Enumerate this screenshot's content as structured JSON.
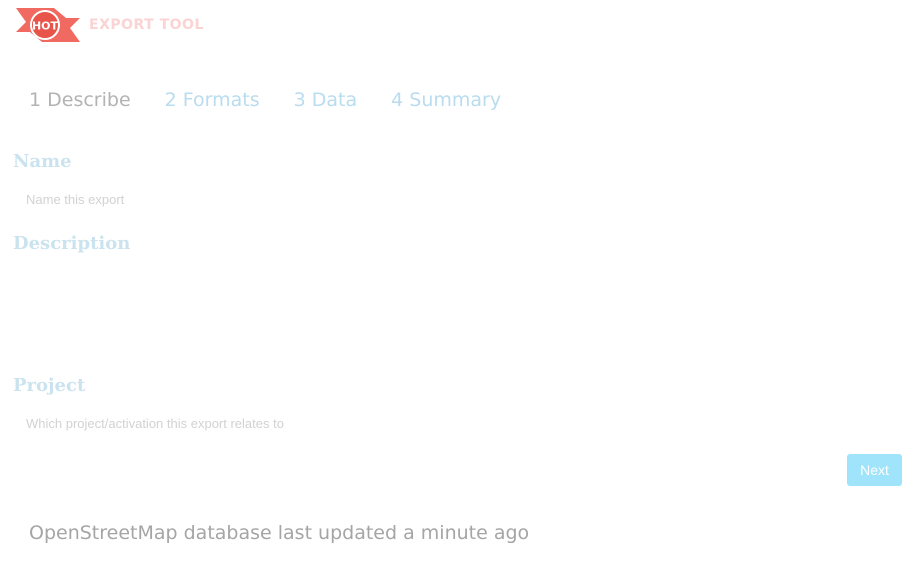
{
  "header": {
    "logo_text": "HOT",
    "brand_title": "EXPORT TOOL",
    "logo_icon": "hot-logo-icon",
    "brand_color": "#e8534a"
  },
  "steps": [
    {
      "label": "1 Describe",
      "active": true
    },
    {
      "label": "2 Formats",
      "active": false
    },
    {
      "label": "3 Data",
      "active": false
    },
    {
      "label": "4 Summary",
      "active": false
    }
  ],
  "form": {
    "name": {
      "label": "Name",
      "placeholder": "Name this export",
      "value": ""
    },
    "description": {
      "label": "Description",
      "value": ""
    },
    "project": {
      "label": "Project",
      "placeholder": "Which project/activation this export relates to",
      "value": ""
    },
    "next_label": "Next"
  },
  "status": {
    "db_updated": "OpenStreetMap database last updated a minute ago"
  },
  "colors": {
    "accent": "#9fe4fb",
    "step_link": "#b9dcef",
    "label": "#cbe3ef"
  }
}
